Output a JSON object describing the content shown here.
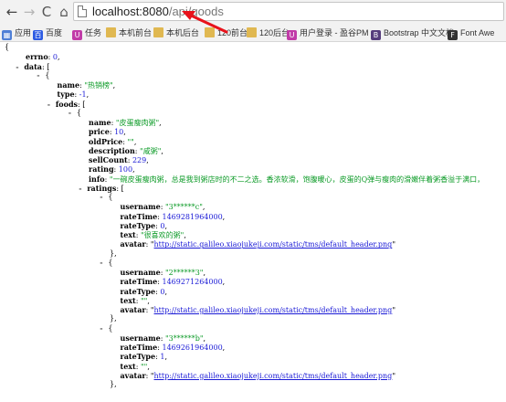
{
  "browser": {
    "back_icon": "←",
    "forward_icon": "→",
    "reload_icon": "C",
    "home_icon": "⌂",
    "url_host": "localhost:8080",
    "url_path": "/api/goods"
  },
  "bookmarks": [
    {
      "label": "应用",
      "icon": "▦",
      "color": "#4f7fd6"
    },
    {
      "label": "百度",
      "icon": "百",
      "color": "#2d5be3"
    },
    {
      "label": "任务",
      "icon": "U",
      "color": "#c13ba8"
    },
    {
      "label": "本机前台",
      "icon": "",
      "color": "#e0b851"
    },
    {
      "label": "本机后台",
      "icon": "",
      "color": "#e0b851"
    },
    {
      "label": "120前台",
      "icon": "",
      "color": "#e0b851"
    },
    {
      "label": "120后台",
      "icon": "",
      "color": "#e0b851"
    },
    {
      "label": "用户登录 - 盈谷PM",
      "icon": "U",
      "color": "#c13ba8"
    },
    {
      "label": "Bootstrap 中文文档",
      "icon": "B",
      "color": "#563d7c"
    },
    {
      "label": "Font Awe",
      "icon": "F",
      "color": "#333333"
    }
  ],
  "json": {
    "lines": [
      {
        "indent": 0,
        "toggle": "",
        "segs": [
          {
            "t": "{",
            "c": "p"
          }
        ]
      },
      {
        "indent": 2,
        "toggle": "",
        "segs": [
          {
            "t": "errno",
            "c": "k"
          },
          {
            "t": ": ",
            "c": "p"
          },
          {
            "t": "0",
            "c": "n"
          },
          {
            "t": ",",
            "c": "p"
          }
        ]
      },
      {
        "indent": 1,
        "toggle": "-",
        "segs": [
          {
            "t": "data",
            "c": "k"
          },
          {
            "t": ": [",
            "c": "p"
          }
        ]
      },
      {
        "indent": 3,
        "toggle": "-",
        "segs": [
          {
            "t": "{",
            "c": "p"
          }
        ]
      },
      {
        "indent": 5,
        "toggle": "",
        "segs": [
          {
            "t": "name",
            "c": "k"
          },
          {
            "t": ": ",
            "c": "p"
          },
          {
            "t": "\"热销榜\"",
            "c": "s"
          },
          {
            "t": ",",
            "c": "p"
          }
        ]
      },
      {
        "indent": 5,
        "toggle": "",
        "segs": [
          {
            "t": "type",
            "c": "k"
          },
          {
            "t": ": ",
            "c": "p"
          },
          {
            "t": "-1",
            "c": "n"
          },
          {
            "t": ",",
            "c": "p"
          }
        ]
      },
      {
        "indent": 4,
        "toggle": "-",
        "segs": [
          {
            "t": "foods",
            "c": "k"
          },
          {
            "t": ": [",
            "c": "p"
          }
        ]
      },
      {
        "indent": 6,
        "toggle": "-",
        "segs": [
          {
            "t": "{",
            "c": "p"
          }
        ]
      },
      {
        "indent": 8,
        "toggle": "",
        "segs": [
          {
            "t": "name",
            "c": "k"
          },
          {
            "t": ": ",
            "c": "p"
          },
          {
            "t": "\"皮蛋瘦肉粥\"",
            "c": "s"
          },
          {
            "t": ",",
            "c": "p"
          }
        ]
      },
      {
        "indent": 8,
        "toggle": "",
        "segs": [
          {
            "t": "price",
            "c": "k"
          },
          {
            "t": ": ",
            "c": "p"
          },
          {
            "t": "10",
            "c": "n"
          },
          {
            "t": ",",
            "c": "p"
          }
        ]
      },
      {
        "indent": 8,
        "toggle": "",
        "segs": [
          {
            "t": "oldPrice",
            "c": "k"
          },
          {
            "t": ": ",
            "c": "p"
          },
          {
            "t": "\"\"",
            "c": "s"
          },
          {
            "t": ",",
            "c": "p"
          }
        ]
      },
      {
        "indent": 8,
        "toggle": "",
        "segs": [
          {
            "t": "description",
            "c": "k"
          },
          {
            "t": ": ",
            "c": "p"
          },
          {
            "t": "\"咸粥\"",
            "c": "s"
          },
          {
            "t": ",",
            "c": "p"
          }
        ]
      },
      {
        "indent": 8,
        "toggle": "",
        "segs": [
          {
            "t": "sellCount",
            "c": "k"
          },
          {
            "t": ": ",
            "c": "p"
          },
          {
            "t": "229",
            "c": "n"
          },
          {
            "t": ",",
            "c": "p"
          }
        ]
      },
      {
        "indent": 8,
        "toggle": "",
        "segs": [
          {
            "t": "rating",
            "c": "k"
          },
          {
            "t": ": ",
            "c": "p"
          },
          {
            "t": "100",
            "c": "n"
          },
          {
            "t": ",",
            "c": "p"
          }
        ]
      },
      {
        "indent": 8,
        "toggle": "",
        "segs": [
          {
            "t": "info",
            "c": "k"
          },
          {
            "t": ": ",
            "c": "p"
          },
          {
            "t": "\"一碗皮蛋瘦肉粥，总是我到粥店时的不二之选。香浓软滑，饱腹暖心，皮蛋的Q弹与瘦肉的滑嫩伴着粥香溢于满口，",
            "c": "s"
          }
        ]
      },
      {
        "indent": 7,
        "toggle": "-",
        "segs": [
          {
            "t": "ratings",
            "c": "k"
          },
          {
            "t": ": [",
            "c": "p"
          }
        ]
      },
      {
        "indent": 9,
        "toggle": "-",
        "segs": [
          {
            "t": "{",
            "c": "p"
          }
        ]
      },
      {
        "indent": 11,
        "toggle": "",
        "segs": [
          {
            "t": "username",
            "c": "k"
          },
          {
            "t": ": ",
            "c": "p"
          },
          {
            "t": "\"3******c\"",
            "c": "s"
          },
          {
            "t": ",",
            "c": "p"
          }
        ]
      },
      {
        "indent": 11,
        "toggle": "",
        "segs": [
          {
            "t": "rateTime",
            "c": "k"
          },
          {
            "t": ": ",
            "c": "p"
          },
          {
            "t": "1469281964000",
            "c": "n"
          },
          {
            "t": ",",
            "c": "p"
          }
        ]
      },
      {
        "indent": 11,
        "toggle": "",
        "segs": [
          {
            "t": "rateType",
            "c": "k"
          },
          {
            "t": ": ",
            "c": "p"
          },
          {
            "t": "0",
            "c": "n"
          },
          {
            "t": ",",
            "c": "p"
          }
        ]
      },
      {
        "indent": 11,
        "toggle": "",
        "segs": [
          {
            "t": "text",
            "c": "k"
          },
          {
            "t": ": ",
            "c": "p"
          },
          {
            "t": "\"很喜欢的粥\"",
            "c": "s"
          },
          {
            "t": ",",
            "c": "p"
          }
        ]
      },
      {
        "indent": 11,
        "toggle": "",
        "segs": [
          {
            "t": "avatar",
            "c": "k"
          },
          {
            "t": ": \"",
            "c": "p"
          },
          {
            "t": "http://static.galileo.xiaojukeji.com/static/tms/default_header.png",
            "c": "u"
          },
          {
            "t": "\"",
            "c": "p"
          }
        ]
      },
      {
        "indent": 10,
        "toggle": "",
        "segs": [
          {
            "t": "},",
            "c": "p"
          }
        ]
      },
      {
        "indent": 9,
        "toggle": "-",
        "segs": [
          {
            "t": "{",
            "c": "p"
          }
        ]
      },
      {
        "indent": 11,
        "toggle": "",
        "segs": [
          {
            "t": "username",
            "c": "k"
          },
          {
            "t": ": ",
            "c": "p"
          },
          {
            "t": "\"2******3\"",
            "c": "s"
          },
          {
            "t": ",",
            "c": "p"
          }
        ]
      },
      {
        "indent": 11,
        "toggle": "",
        "segs": [
          {
            "t": "rateTime",
            "c": "k"
          },
          {
            "t": ": ",
            "c": "p"
          },
          {
            "t": "1469271264000",
            "c": "n"
          },
          {
            "t": ",",
            "c": "p"
          }
        ]
      },
      {
        "indent": 11,
        "toggle": "",
        "segs": [
          {
            "t": "rateType",
            "c": "k"
          },
          {
            "t": ": ",
            "c": "p"
          },
          {
            "t": "0",
            "c": "n"
          },
          {
            "t": ",",
            "c": "p"
          }
        ]
      },
      {
        "indent": 11,
        "toggle": "",
        "segs": [
          {
            "t": "text",
            "c": "k"
          },
          {
            "t": ": ",
            "c": "p"
          },
          {
            "t": "\"\"",
            "c": "s"
          },
          {
            "t": ",",
            "c": "p"
          }
        ]
      },
      {
        "indent": 11,
        "toggle": "",
        "segs": [
          {
            "t": "avatar",
            "c": "k"
          },
          {
            "t": ": \"",
            "c": "p"
          },
          {
            "t": "http://static.galileo.xiaojukeji.com/static/tms/default_header.png",
            "c": "u"
          },
          {
            "t": "\"",
            "c": "p"
          }
        ]
      },
      {
        "indent": 10,
        "toggle": "",
        "segs": [
          {
            "t": "},",
            "c": "p"
          }
        ]
      },
      {
        "indent": 9,
        "toggle": "-",
        "segs": [
          {
            "t": "{",
            "c": "p"
          }
        ]
      },
      {
        "indent": 11,
        "toggle": "",
        "segs": [
          {
            "t": "username",
            "c": "k"
          },
          {
            "t": ": ",
            "c": "p"
          },
          {
            "t": "\"3******b\"",
            "c": "s"
          },
          {
            "t": ",",
            "c": "p"
          }
        ]
      },
      {
        "indent": 11,
        "toggle": "",
        "segs": [
          {
            "t": "rateTime",
            "c": "k"
          },
          {
            "t": ": ",
            "c": "p"
          },
          {
            "t": "1469261964000",
            "c": "n"
          },
          {
            "t": ",",
            "c": "p"
          }
        ]
      },
      {
        "indent": 11,
        "toggle": "",
        "segs": [
          {
            "t": "rateType",
            "c": "k"
          },
          {
            "t": ": ",
            "c": "p"
          },
          {
            "t": "1",
            "c": "n"
          },
          {
            "t": ",",
            "c": "p"
          }
        ]
      },
      {
        "indent": 11,
        "toggle": "",
        "segs": [
          {
            "t": "text",
            "c": "k"
          },
          {
            "t": ": ",
            "c": "p"
          },
          {
            "t": "\"\"",
            "c": "s"
          },
          {
            "t": ",",
            "c": "p"
          }
        ]
      },
      {
        "indent": 11,
        "toggle": "",
        "segs": [
          {
            "t": "avatar",
            "c": "k"
          },
          {
            "t": ": \"",
            "c": "p"
          },
          {
            "t": "http://static.galileo.xiaojukeji.com/static/tms/default_header.png",
            "c": "u"
          },
          {
            "t": "\"",
            "c": "p"
          }
        ]
      },
      {
        "indent": 10,
        "toggle": "",
        "segs": [
          {
            "t": "},",
            "c": "p"
          }
        ]
      }
    ]
  }
}
